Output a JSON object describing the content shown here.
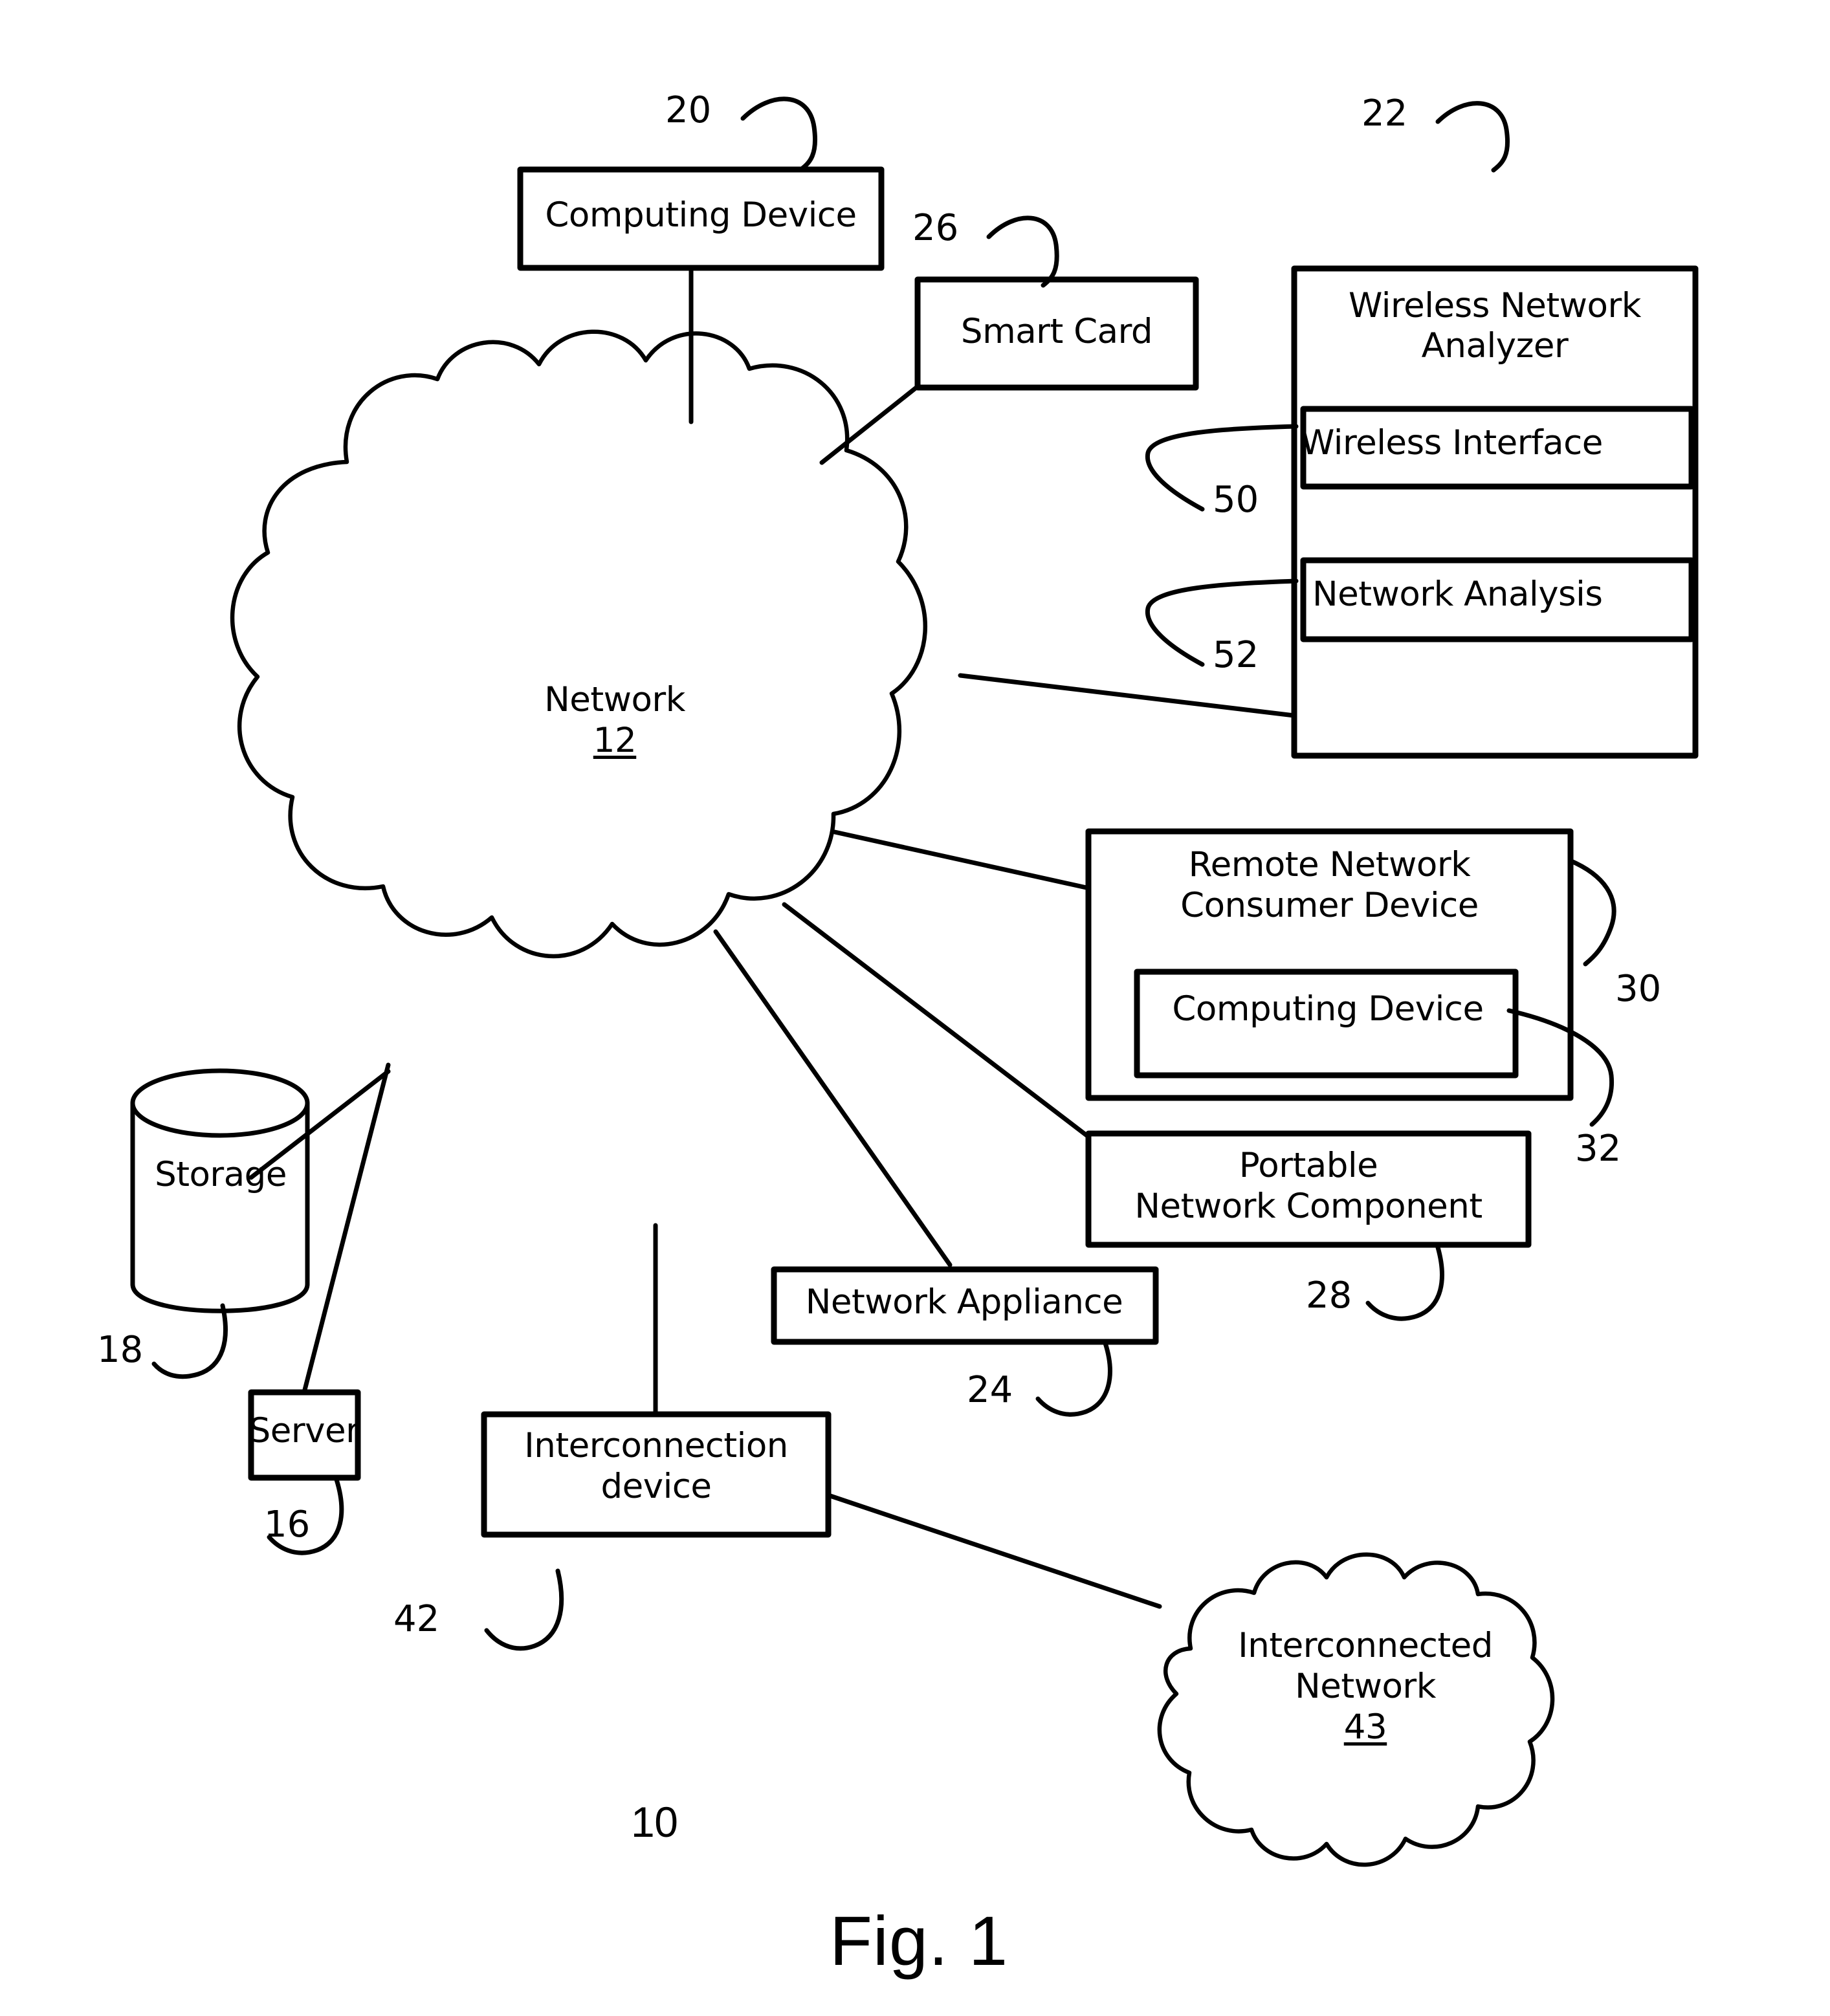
{
  "figure": {
    "caption": "Fig. 1",
    "system_ref": "10"
  },
  "nodes": {
    "computing_device": {
      "label": "Computing Device",
      "ref": "20"
    },
    "smart_card": {
      "label": "Smart Card",
      "ref": "26"
    },
    "wireless_network_analyzer": {
      "label_line1": "Wireless Network",
      "label_line2": "Analyzer",
      "ref": "22",
      "children": [
        {
          "label": "Wireless Interface",
          "ref": "50"
        },
        {
          "label": "Network Analysis",
          "ref": "52"
        }
      ]
    },
    "network_cloud": {
      "label": "Network",
      "ref": "12"
    },
    "remote_network_consumer_device": {
      "label_line1": "Remote Network",
      "label_line2": "Consumer Device",
      "ref": "30",
      "child": {
        "label": "Computing Device",
        "ref": "32"
      }
    },
    "portable_network_component": {
      "label_line1": "Portable",
      "label_line2": "Network Component",
      "ref": "28"
    },
    "network_appliance": {
      "label": "Network Appliance",
      "ref": "24"
    },
    "storage": {
      "label": "Storage",
      "ref": "18"
    },
    "server": {
      "label": "Server",
      "ref": "16"
    },
    "interconnection_device": {
      "label_line1": "Interconnection",
      "label_line2": "device",
      "ref": "42"
    },
    "interconnected_network": {
      "label_line1": "Interconnected",
      "label_line2": "Network",
      "ref": "43"
    }
  },
  "colors": {
    "ink": "#000000",
    "paper": "#ffffff"
  }
}
